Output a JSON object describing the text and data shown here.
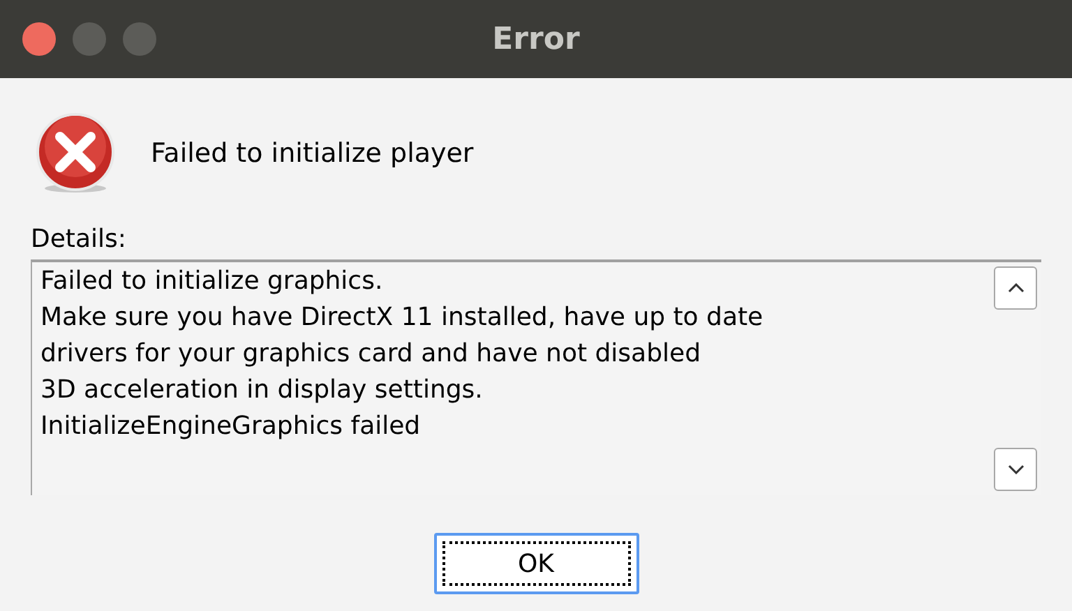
{
  "window": {
    "title": "Error"
  },
  "message": "Failed to initialize player",
  "details": {
    "label": "Details:",
    "lines": [
      "Failed to initialize graphics.",
      "Make sure you have DirectX 11 installed, have up to date",
      "drivers for your graphics card and have not disabled",
      "3D acceleration in display settings.",
      "InitializeEngineGraphics failed"
    ]
  },
  "buttons": [
    {
      "label": "OK",
      "focused": true
    }
  ]
}
